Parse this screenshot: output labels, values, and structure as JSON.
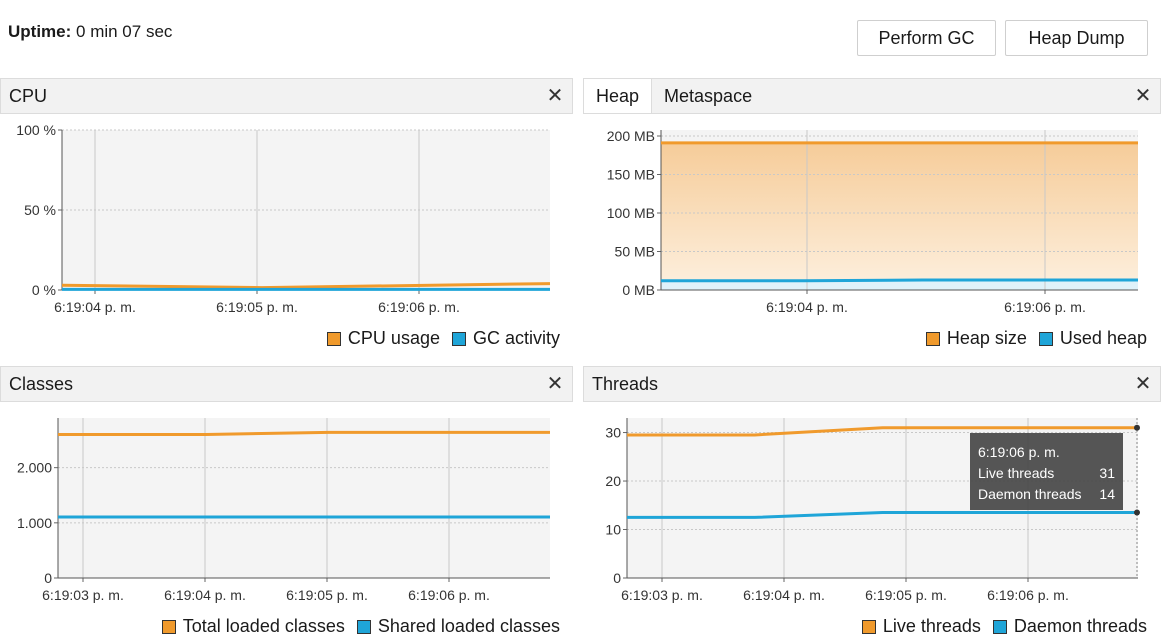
{
  "header": {
    "uptime_label": "Uptime:",
    "uptime_value": "0 min 07 sec",
    "perform_gc": "Perform GC",
    "heap_dump": "Heap Dump"
  },
  "colors": {
    "orange": "#f09a2c",
    "blue": "#1fa5d8",
    "heap_fill_top": "#f6cc99",
    "heap_fill_bottom": "#fdf0df"
  },
  "cpu": {
    "title": "CPU",
    "legend": [
      "CPU usage",
      "GC activity"
    ]
  },
  "memory": {
    "tabs": [
      "Heap",
      "Metaspace"
    ],
    "legend": [
      "Heap size",
      "Used heap"
    ]
  },
  "classes": {
    "title": "Classes",
    "legend": [
      "Total loaded classes",
      "Shared loaded classes"
    ]
  },
  "threads": {
    "title": "Threads",
    "legend": [
      "Live threads",
      "Daemon threads"
    ],
    "tooltip": {
      "time": "6:19:06 p. m.",
      "live_label": "Live threads",
      "live_value": "31",
      "daemon_label": "Daemon threads",
      "daemon_value": "14"
    }
  },
  "chart_data": [
    {
      "type": "line",
      "name": "cpu",
      "x": [
        "6:19:04 p. m.",
        "6:19:05 p. m.",
        "6:19:06 p. m."
      ],
      "yticks": [
        "0 %",
        "50 %",
        "100 %"
      ],
      "ylim": [
        0,
        100
      ],
      "xlim": [
        -0.25,
        2.8
      ],
      "series": [
        {
          "name": "CPU usage",
          "points": [
            [
              -0.25,
              3
            ],
            [
              1,
              1.5
            ],
            [
              2.8,
              4
            ]
          ]
        },
        {
          "name": "GC activity",
          "points": [
            [
              -0.25,
              0.4
            ],
            [
              2.8,
              0.4
            ]
          ]
        }
      ],
      "grid": true
    },
    {
      "type": "area",
      "name": "heap",
      "x": [
        "6:19:04 p. m.",
        "6:19:06 p. m."
      ],
      "yticks": [
        "0 MB",
        "50 MB",
        "100 MB",
        "150 MB",
        "200 MB"
      ],
      "ylim": [
        0,
        200
      ],
      "xlim": [
        -0.6,
        1.4
      ],
      "series": [
        {
          "name": "Heap size",
          "points": [
            [
              -0.6,
              191
            ],
            [
              1.4,
              191
            ]
          ]
        },
        {
          "name": "Used heap",
          "points": [
            [
              -0.6,
              12
            ],
            [
              0,
              12
            ],
            [
              0.5,
              13
            ],
            [
              1.4,
              13
            ]
          ]
        }
      ],
      "grid": true
    },
    {
      "type": "line",
      "name": "classes",
      "x": [
        "6:19:03 p. m.",
        "6:19:04 p. m.",
        "6:19:05 p. m.",
        "6:19:06 p. m."
      ],
      "yticks": [
        "0",
        "1.000",
        "2.000"
      ],
      "ytick_values": [
        0,
        1000,
        2000
      ],
      "ylim": [
        0,
        2900
      ],
      "xlim": [
        -0.2,
        3.8
      ],
      "series": [
        {
          "name": "Total loaded classes",
          "points": [
            [
              -0.2,
              2600
            ],
            [
              1,
              2600
            ],
            [
              2,
              2640
            ],
            [
              3.8,
              2640
            ]
          ]
        },
        {
          "name": "Shared loaded classes",
          "points": [
            [
              -0.2,
              1105
            ],
            [
              3.8,
              1105
            ]
          ]
        }
      ],
      "grid": true
    },
    {
      "type": "line",
      "name": "threads",
      "x": [
        "6:19:03 p. m.",
        "6:19:04 p. m.",
        "6:19:05 p. m.",
        "6:19:06 p. m."
      ],
      "yticks": [
        "0",
        "10",
        "20",
        "30"
      ],
      "ytick_values": [
        0,
        10,
        20,
        30
      ],
      "ylim": [
        0,
        33
      ],
      "xlim": [
        -0.2,
        3.8
      ],
      "series": [
        {
          "name": "Live threads",
          "points": [
            [
              -0.2,
              29.5
            ],
            [
              0.8,
              29.5
            ],
            [
              1.8,
              31
            ],
            [
              3.8,
              31
            ]
          ]
        },
        {
          "name": "Daemon threads",
          "points": [
            [
              -0.2,
              12.5
            ],
            [
              0.8,
              12.5
            ],
            [
              1.8,
              13.5
            ],
            [
              3.8,
              13.5
            ]
          ]
        }
      ],
      "grid": true
    }
  ]
}
